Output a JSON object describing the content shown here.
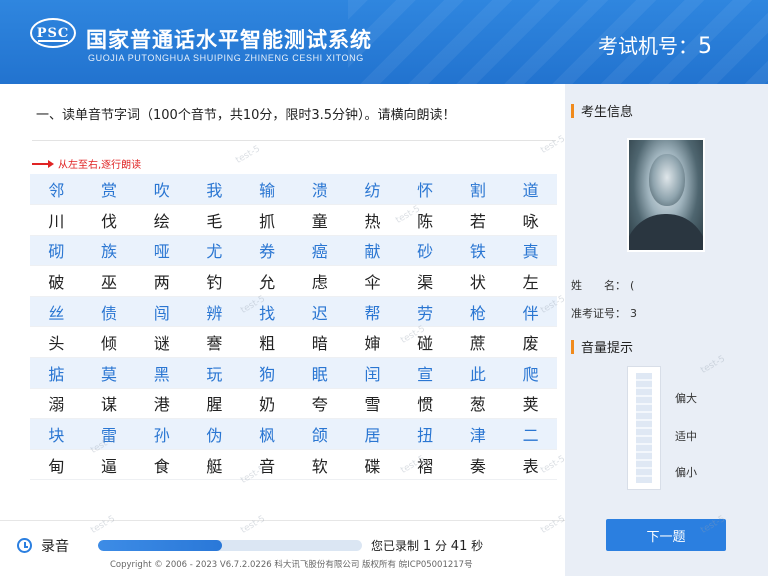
{
  "header": {
    "logo_text": "PSC",
    "title": "国家普通话水平智能测试系统",
    "subtitle": "GUOJIA PUTONGHUA SHUIPING ZHINENG CESHI XITONG",
    "exam_no_label": "考试机号：",
    "exam_no_value": "5"
  },
  "main": {
    "instruction": "一、读单音节字词（100个音节，共10分，限时3.5分钟）。请横向朗读！",
    "direction": "从左至右,逐行朗读",
    "rows": [
      [
        "邻",
        "赏",
        "吹",
        "我",
        "输",
        "溃",
        "纺",
        "怀",
        "割",
        "道"
      ],
      [
        "川",
        "伐",
        "绘",
        "毛",
        "抓",
        "童",
        "热",
        "陈",
        "若",
        "咏"
      ],
      [
        "砌",
        "族",
        "哑",
        "尤",
        "券",
        "癌",
        "献",
        "砂",
        "铁",
        "真"
      ],
      [
        "破",
        "巫",
        "两",
        "钓",
        "允",
        "虑",
        "伞",
        "渠",
        "状",
        "左"
      ],
      [
        "丝",
        "债",
        "闯",
        "辨",
        "找",
        "迟",
        "帮",
        "劳",
        "枪",
        "伴"
      ],
      [
        "头",
        "倾",
        "谜",
        "謇",
        "粗",
        "暗",
        "婶",
        "碰",
        "蔗",
        "废"
      ],
      [
        "掂",
        "莫",
        "黑",
        "玩",
        "狗",
        "眠",
        "闰",
        "宣",
        "此",
        "爬"
      ],
      [
        "溺",
        "谋",
        "港",
        "腥",
        "奶",
        "夸",
        "雪",
        "惯",
        "葱",
        "荚"
      ],
      [
        "块",
        "雷",
        "孙",
        "伪",
        "枫",
        "颌",
        "居",
        "扭",
        "津",
        "二"
      ],
      [
        "甸",
        "逼",
        "食",
        "艇",
        "音",
        "软",
        "碟",
        "褶",
        "奏",
        "表"
      ]
    ]
  },
  "sidebar": {
    "candidate_title": "考生信息",
    "name_label": "姓　　名：",
    "name_value": "(",
    "id_label": "准考证号：",
    "id_value": "3",
    "volume_title": "音量提示",
    "vol_high": "偏大",
    "vol_mid": "适中",
    "vol_low": "偏小",
    "next_button": "下一题"
  },
  "footer": {
    "record_label": "录音",
    "progress_fraction": 0.47,
    "status_prefix": "您已录制",
    "minutes": "1",
    "min_unit": "分",
    "seconds": "41",
    "sec_unit": "秒",
    "copyright": "Copyright © 2006 - 2023 V6.7.2.0226 科大讯飞股份有限公司 版权所有 皖ICP05001217号"
  },
  "watermark": "test-5",
  "colors": {
    "header_blue": "#2273cf",
    "accent_orange": "#f08a1c",
    "char_blue": "#2a76d2",
    "direction_red": "#e02424"
  }
}
